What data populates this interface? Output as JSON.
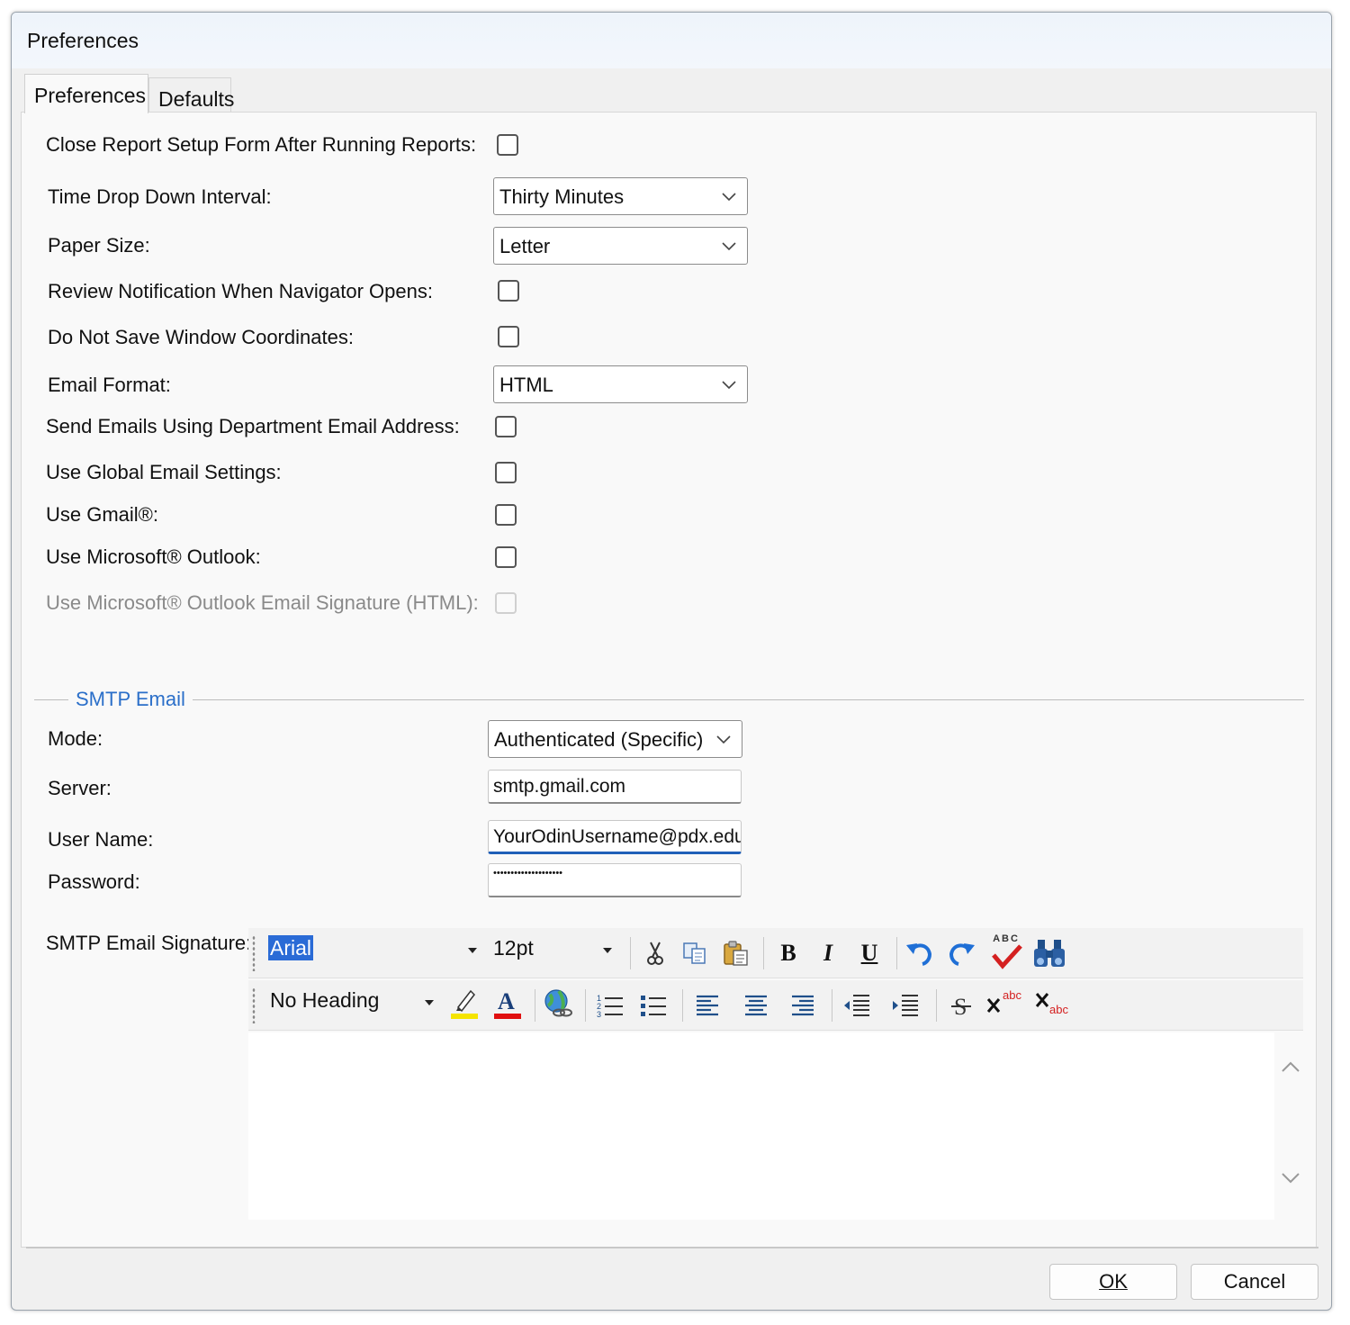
{
  "window": {
    "title": "Preferences"
  },
  "tabs": [
    {
      "label": "Preferences",
      "active": true
    },
    {
      "label": "Defaults",
      "active": false
    }
  ],
  "prefs": {
    "close_report_label": "Close Report Setup Form After Running Reports:",
    "close_report_checked": false,
    "time_interval_label": "Time Drop Down Interval:",
    "time_interval_value": "Thirty Minutes",
    "paper_size_label": "Paper Size:",
    "paper_size_value": "Letter",
    "review_notification_label": "Review Notification When Navigator Opens:",
    "review_notification_checked": false,
    "no_save_coords_label": "Do Not Save Window Coordinates:",
    "no_save_coords_checked": false,
    "email_format_label": "Email Format:",
    "email_format_value": "HTML",
    "dept_email_label": "Send Emails Using Department Email Address:",
    "dept_email_checked": false,
    "global_email_label": "Use Global Email Settings:",
    "global_email_checked": false,
    "gmail_label": "Use Gmail®:",
    "gmail_checked": false,
    "outlook_label": "Use Microsoft® Outlook:",
    "outlook_checked": false,
    "outlook_sig_label": "Use Microsoft® Outlook Email Signature (HTML):",
    "outlook_sig_checked": false,
    "outlook_sig_enabled": false
  },
  "smtp": {
    "group_title": "SMTP Email",
    "mode_label": "Mode:",
    "mode_value": "Authenticated (Specific)",
    "server_label": "Server:",
    "server_value": "smtp.gmail.com",
    "username_label": "User Name:",
    "username_value": "YourOdinUsername@pdx.edu",
    "password_label": "Password:",
    "password_value": "••••••••••••••••••••",
    "signature_label": "SMTP Email Signature:"
  },
  "editor_toolbar": {
    "font_value": "Arial",
    "size_value": "12pt",
    "heading_value": "No Heading",
    "bold_glyph": "B",
    "italic_glyph": "I",
    "underline_glyph": "U",
    "spell_glyph": "ABC",
    "colors": {
      "highlight": "#f5e400",
      "font_color": "#e01010",
      "undo": "#1f6fd6",
      "spellcheck": "#d42020"
    }
  },
  "buttons": {
    "ok": "OK",
    "cancel": "Cancel"
  }
}
